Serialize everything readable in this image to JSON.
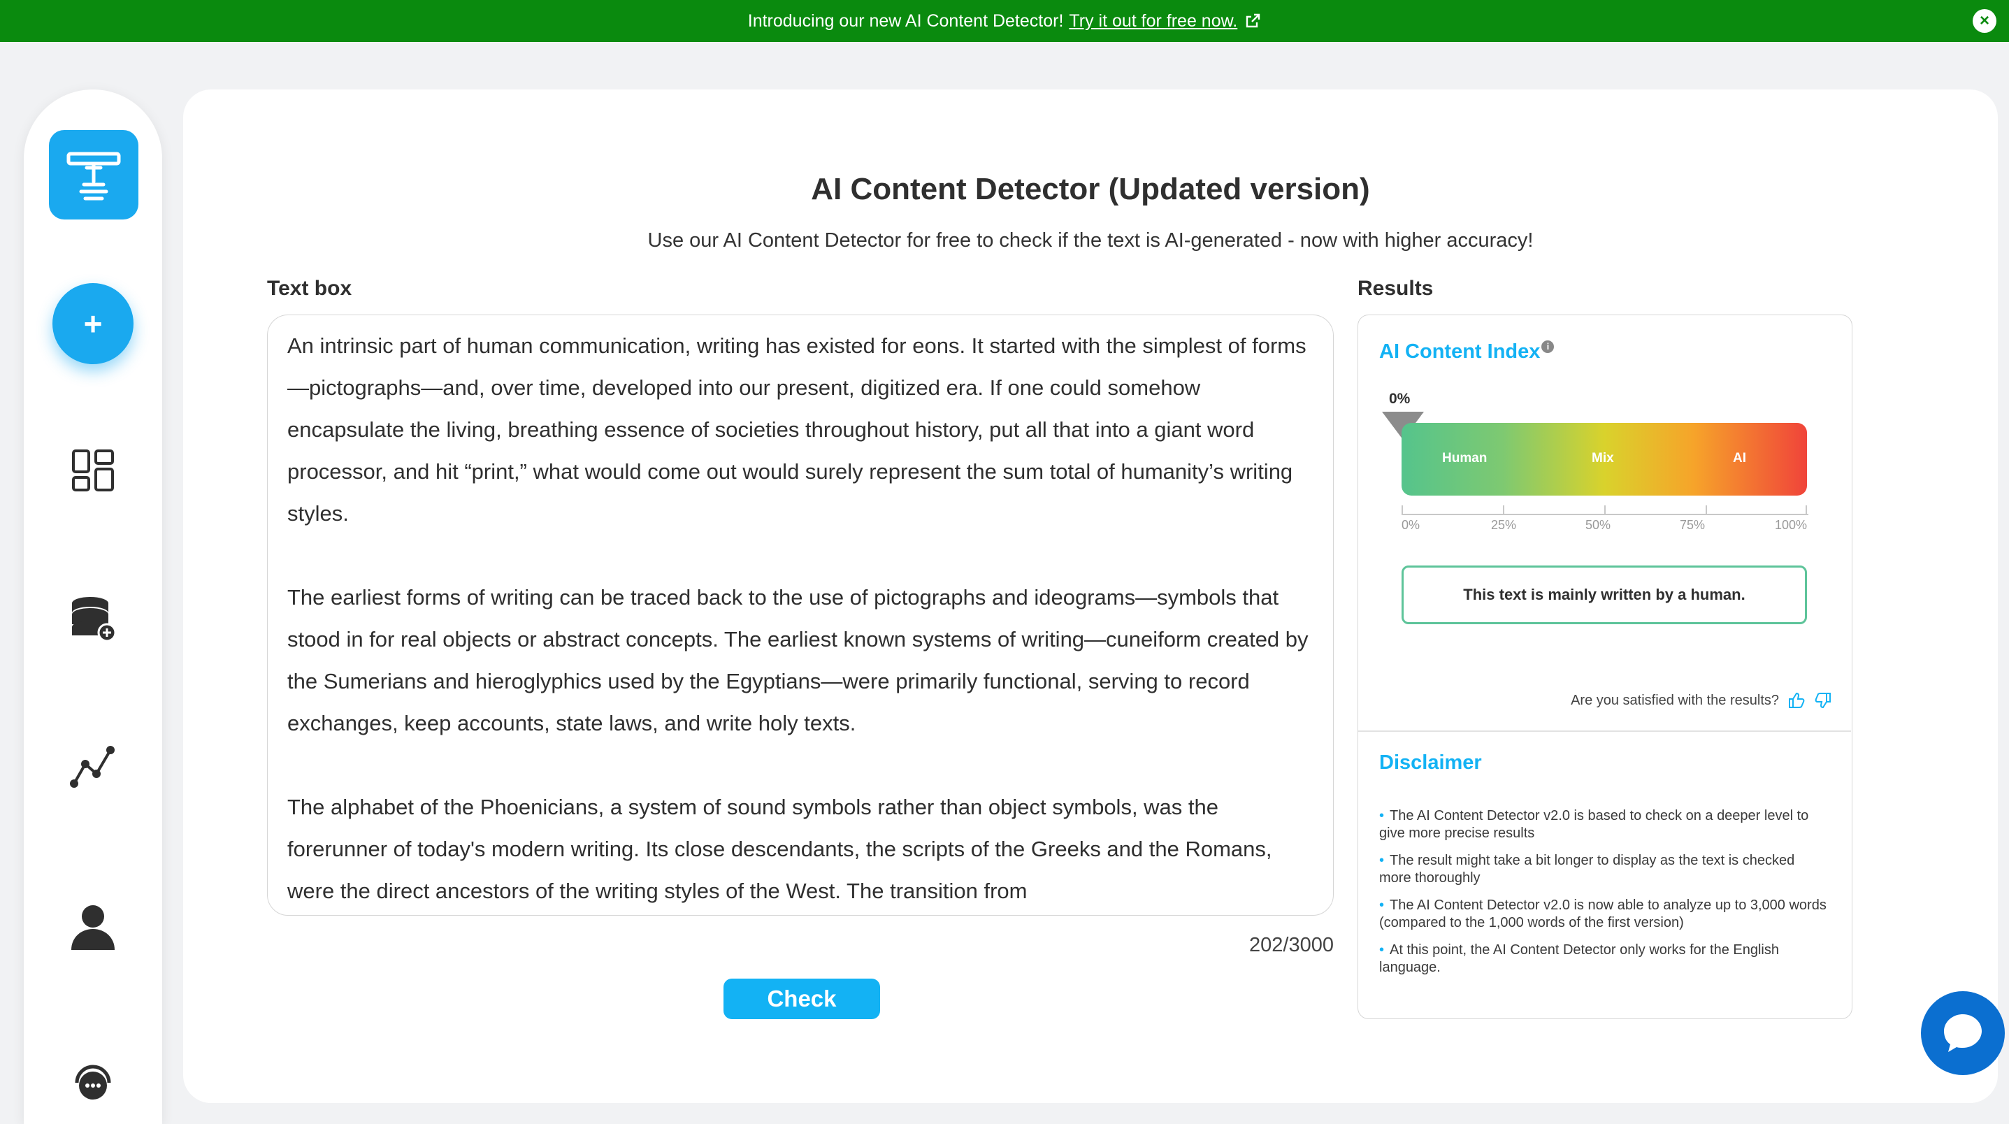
{
  "banner": {
    "text": "Introducing our new AI Content Detector!",
    "link": "Try it out for free now.",
    "close_icon": "close-icon",
    "external_icon": "external-link-icon",
    "color": "#0a8a0e"
  },
  "sidebar": {
    "items": [
      {
        "name": "logo",
        "icon": "text-logo-icon"
      },
      {
        "name": "new",
        "icon": "plus-icon",
        "label": "+"
      },
      {
        "name": "dashboard",
        "icon": "dashboard-icon"
      },
      {
        "name": "credits",
        "icon": "coins-icon"
      },
      {
        "name": "analytics",
        "icon": "analytics-icon"
      },
      {
        "name": "account",
        "icon": "user-icon"
      },
      {
        "name": "support",
        "icon": "support-icon"
      }
    ]
  },
  "main": {
    "title": "AI Content Detector (Updated version)",
    "subtitle": "Use our AI Content Detector for free to check if the text is AI-generated - now with higher accuracy!",
    "textbox_label": "Text box",
    "results_label": "Results",
    "paragraphs": [
      "An intrinsic part of human communication, writing has existed for eons. It started with the simplest of forms—pictographs—and, over time, developed into our present, digitized era. If one could somehow encapsulate the living, breathing essence of societies throughout history, put all that into a giant word processor, and hit “print,” what would come out would surely represent the sum total of humanity’s writing styles.",
      "The earliest forms of writing can be traced back to the use of pictographs and ideograms—symbols that stood in for real objects or abstract concepts. The earliest known systems of writing—cuneiform created by the Sumerians and hieroglyphics used by the Egyptians—were primarily functional, serving to record exchanges, keep accounts, state laws, and write holy texts.",
      "The alphabet of the Phoenicians, a system of sound symbols rather than object symbols, was the forerunner of today's modern writing. Its close descendants, the scripts of the Greeks and the Romans, were the direct ancestors of the writing styles of the West. The transition from"
    ],
    "word_count": "202/3000",
    "check_button": "Check"
  },
  "results": {
    "index_title": "AI Content Index",
    "info_icon": "info-icon",
    "info_glyph": "i",
    "score_label": "0%",
    "score_value": 0,
    "bar_labels": [
      "Human",
      "Mix",
      "AI"
    ],
    "ticks": [
      "0%",
      "25%",
      "50%",
      "75%",
      "100%"
    ],
    "verdict": "This text is mainly written by a human.",
    "satisfied_question": "Are you satisfied with the results?",
    "thumbs_up_icon": "thumbs-up-icon",
    "thumbs_down_icon": "thumbs-down-icon",
    "disclaimer_title": "Disclaimer",
    "disclaimers": [
      "The AI Content Detector v2.0 is based to check on a deeper level to give more precise results",
      "The result might take a bit longer to display as the text is checked more thoroughly",
      "The AI Content Detector v2.0 is now able to analyze up to 3,000 words (compared to the 1,000 words of the first version)",
      "At this point, the AI Content Detector only works for the English language."
    ]
  },
  "chat": {
    "icon": "chat-icon"
  },
  "colors": {
    "accent": "#13b2f4",
    "verdict_border": "#5ec49a"
  }
}
